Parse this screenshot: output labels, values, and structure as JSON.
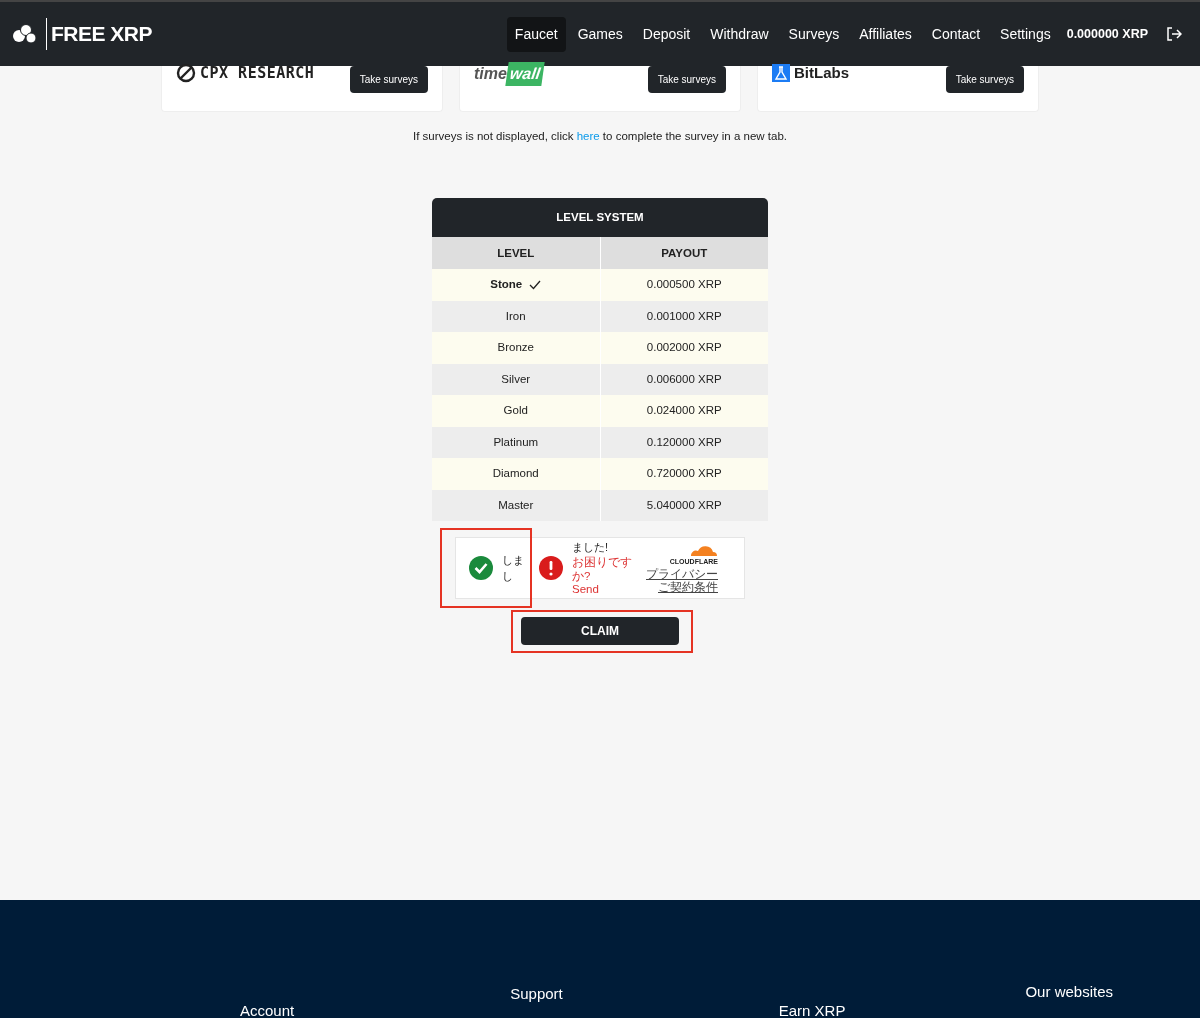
{
  "navbar": {
    "brand": "FREE XRP",
    "links": [
      {
        "label": "Faucet",
        "selected": true
      },
      {
        "label": "Games",
        "selected": false
      },
      {
        "label": "Deposit",
        "selected": false
      },
      {
        "label": "Withdraw",
        "selected": false
      },
      {
        "label": "Surveys",
        "selected": false
      },
      {
        "label": "Affiliates",
        "selected": false
      },
      {
        "label": "Contact",
        "selected": false
      },
      {
        "label": "Settings",
        "selected": false
      }
    ],
    "balance": "0.000000 XRP"
  },
  "survey_walls": [
    {
      "kind": "cpx",
      "name": "CPX RESEARCH",
      "button": "Take surveys"
    },
    {
      "kind": "timewall",
      "name": "time",
      "name_accent": "wall",
      "button": "Take surveys"
    },
    {
      "kind": "bitlabs",
      "name": "BitLabs",
      "button": "Take surveys"
    }
  ],
  "survey_note": {
    "before": "If surveys is not displayed, click ",
    "link": "here",
    "after": " to complete the survey in a new tab."
  },
  "level_system": {
    "title": "LEVEL SYSTEM",
    "columns": [
      "LEVEL",
      "PAYOUT"
    ],
    "rows": [
      {
        "level": "Stone",
        "payout": "0.000500 XRP",
        "selected": true
      },
      {
        "level": "Iron",
        "payout": "0.001000 XRP",
        "selected": false
      },
      {
        "level": "Bronze",
        "payout": "0.002000 XRP",
        "selected": false
      },
      {
        "level": "Silver",
        "payout": "0.006000 XRP",
        "selected": false
      },
      {
        "level": "Gold",
        "payout": "0.024000 XRP",
        "selected": false
      },
      {
        "level": "Platinum",
        "payout": "0.120000 XRP",
        "selected": false
      },
      {
        "level": "Diamond",
        "payout": "0.720000 XRP",
        "selected": false
      },
      {
        "level": "Master",
        "payout": "5.040000 XRP",
        "selected": false
      }
    ]
  },
  "captcha": {
    "success_text": [
      "しま",
      "し"
    ],
    "error_text": "ました!",
    "help": [
      "お困りです",
      "か?"
    ],
    "send": "Send",
    "brand": "CLOUDFLARE",
    "links": [
      "プライバシー",
      "ご契約条件"
    ]
  },
  "claim_button": "CLAIM",
  "footer": {
    "headings": [
      "Account",
      "Support",
      "Earn XRP",
      "Our websites"
    ]
  }
}
